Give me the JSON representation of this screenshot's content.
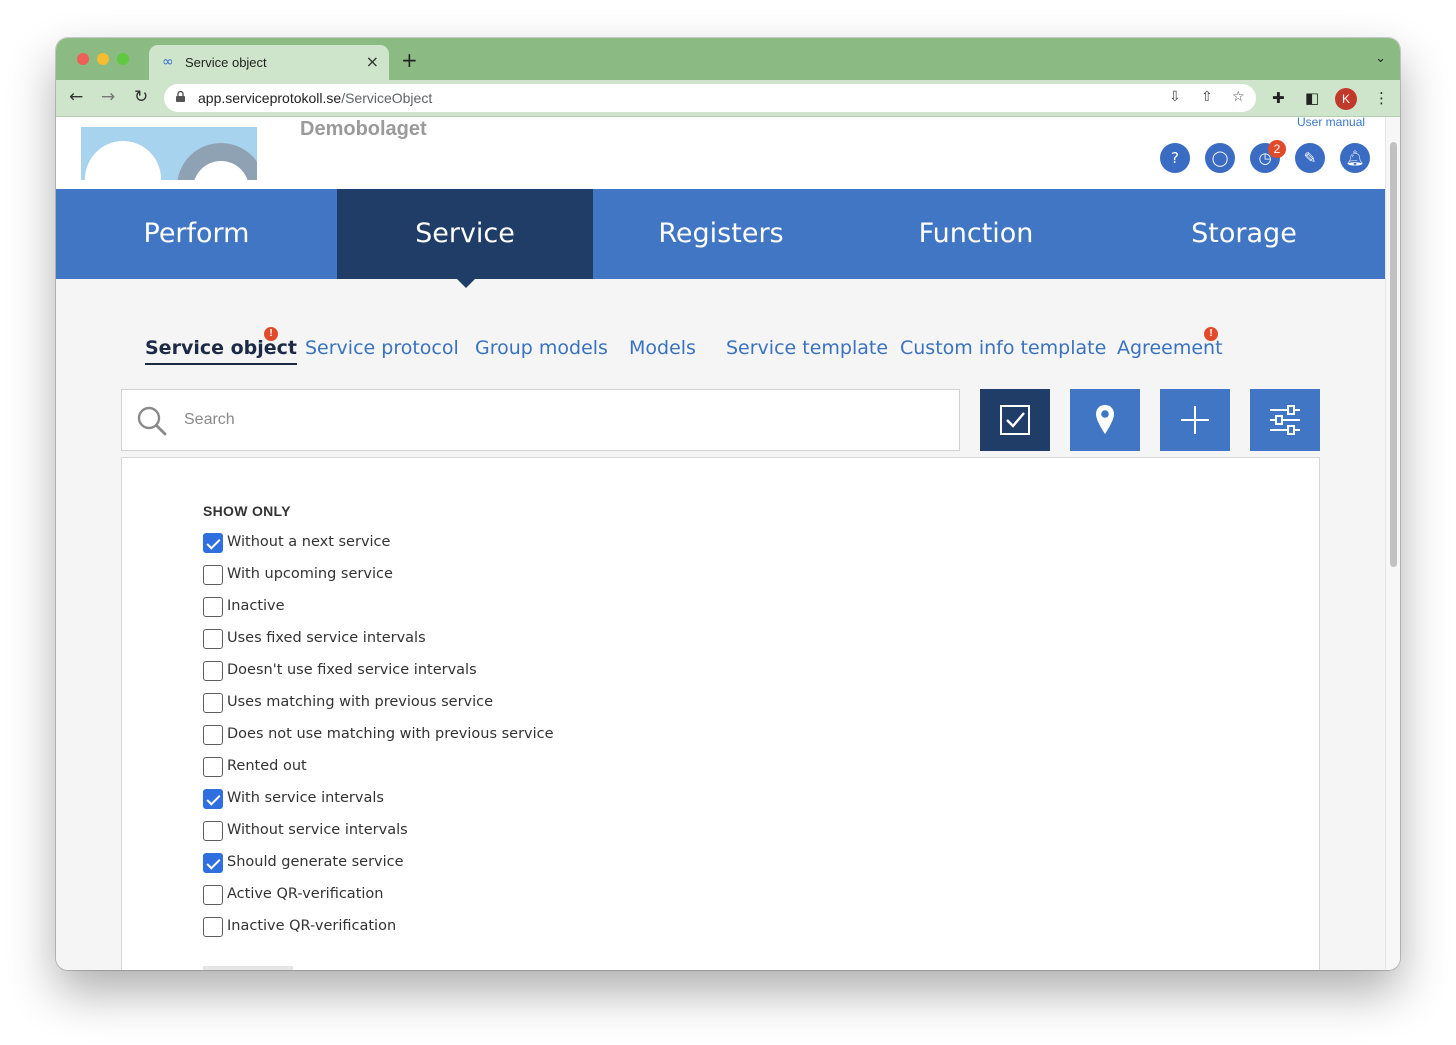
{
  "browser": {
    "tab_title": "Service object",
    "new_tab": "+",
    "close": "×",
    "url_host": "app.serviceprotokoll.se",
    "url_path": "/ServiceObject",
    "avatar_letter": "K"
  },
  "header": {
    "company": "Demobolaget",
    "user_manual": "User manual",
    "notification_count": "2",
    "icons": [
      "help-icon",
      "chat-icon",
      "clock-icon",
      "pen-icon",
      "bell-icon"
    ]
  },
  "main_nav": [
    {
      "label": "Perform"
    },
    {
      "label": "Service"
    },
    {
      "label": "Registers"
    },
    {
      "label": "Function"
    },
    {
      "label": "Storage"
    }
  ],
  "sub_nav": [
    {
      "label": "Service object"
    },
    {
      "label": "Service protocol"
    },
    {
      "label": "Group models"
    },
    {
      "label": "Models"
    },
    {
      "label": "Service template"
    },
    {
      "label": "Custom info template"
    },
    {
      "label": "Agreement"
    }
  ],
  "search": {
    "placeholder": "Search"
  },
  "filters": {
    "heading": "SHOW ONLY",
    "items": [
      {
        "label": "Without a next service",
        "checked": true
      },
      {
        "label": "With upcoming service",
        "checked": false
      },
      {
        "label": "Inactive",
        "checked": false
      },
      {
        "label": "Uses fixed service intervals",
        "checked": false
      },
      {
        "label": "Doesn't use fixed service intervals",
        "checked": false
      },
      {
        "label": "Uses matching with previous service",
        "checked": false
      },
      {
        "label": "Does not use matching with previous service",
        "checked": false
      },
      {
        "label": "Rented out",
        "checked": false
      },
      {
        "label": "With service intervals",
        "checked": true
      },
      {
        "label": "Without service intervals",
        "checked": false
      },
      {
        "label": "Should generate service",
        "checked": true
      },
      {
        "label": "Active QR-verification",
        "checked": false
      },
      {
        "label": "Inactive QR-verification",
        "checked": false
      }
    ]
  },
  "colors": {
    "nav_blue": "#4176c4",
    "nav_active": "#1f3d66",
    "link_blue": "#3a72c2",
    "checkbox_blue": "#2f6fe0",
    "alert_red": "#e14b2b",
    "browser_green": "#8bbb82"
  }
}
